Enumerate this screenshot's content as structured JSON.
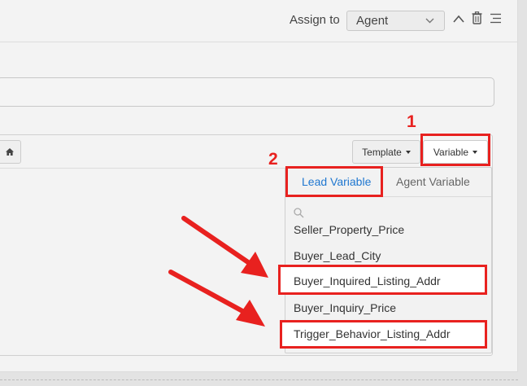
{
  "header": {
    "assign_label": "Assign to",
    "assign_value": "Agent",
    "icons": [
      "chevron-up-icon",
      "trash-icon",
      "menu-icon"
    ]
  },
  "toolbar": {
    "template_label": "Template",
    "variable_label": "Variable",
    "home_icon": "home-icon"
  },
  "dropdown": {
    "tabs": [
      {
        "label": "Lead Variable",
        "active": true
      },
      {
        "label": "Agent Variable",
        "active": false
      }
    ],
    "search_icon": "search-icon",
    "options": [
      "Seller_Property_Price",
      "Buyer_Lead_City",
      "Buyer_Inquired_Listing_Addr",
      "Buyer_Inquiry_Price",
      "Trigger_Behavior_Listing_Addr"
    ]
  },
  "annotations": {
    "step1": "1",
    "step2": "2",
    "highlight_color": "#e8211f"
  }
}
